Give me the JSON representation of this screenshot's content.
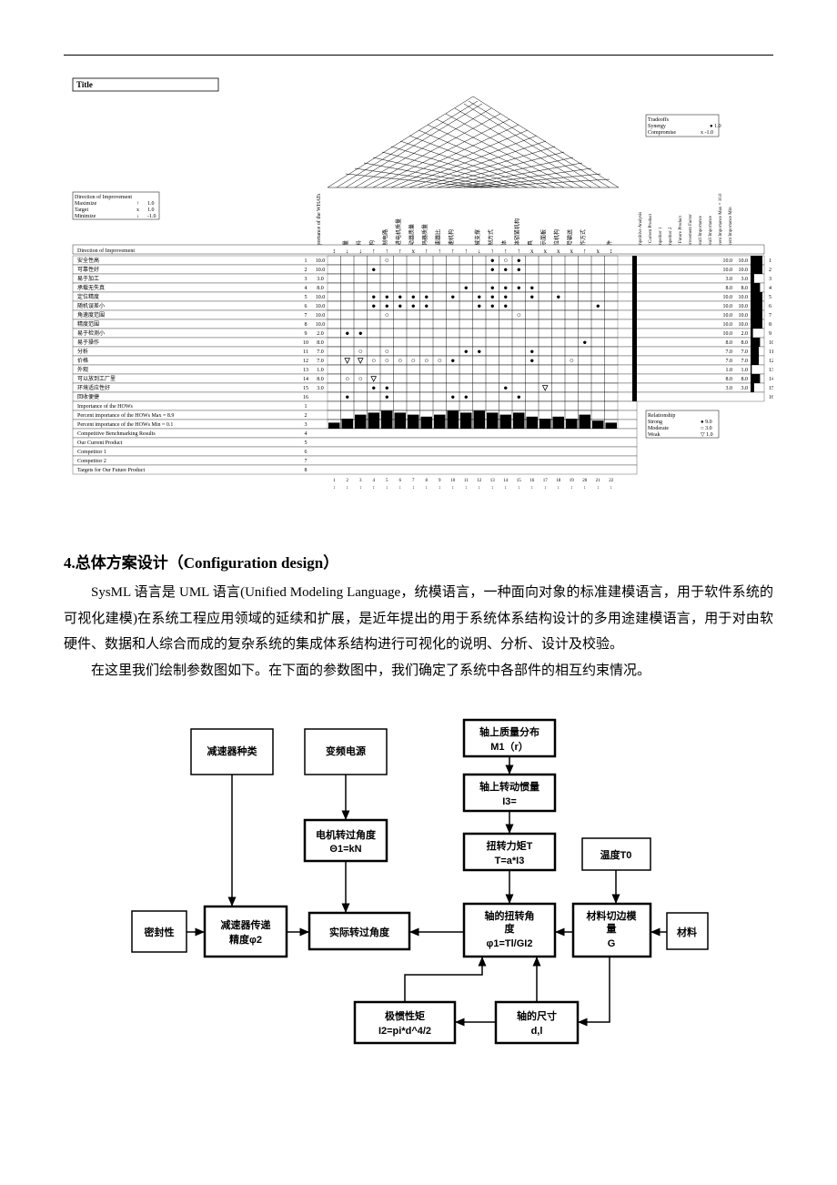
{
  "qfd": {
    "title_label": "Title",
    "legend_improve": {
      "header": "Direction of Improvement",
      "rows": [
        [
          "Maximize",
          "↑",
          "1.0"
        ],
        [
          "Target",
          "x",
          "1.0"
        ],
        [
          "Minimize",
          "↓",
          "-1.0"
        ]
      ]
    },
    "legend_tradeoff": {
      "header": "Tradeoffs",
      "rows": [
        [
          "Synergy",
          "● 1.0"
        ],
        [
          "Compromise",
          "x -1.0"
        ]
      ]
    },
    "legend_rel": {
      "header": "Relationship",
      "rows": [
        [
          "Strong",
          "● 9.0"
        ],
        [
          "Moderate",
          "○ 3.0"
        ],
        [
          "Weak",
          "▽ 1.0"
        ]
      ]
    },
    "row_header_improve": "Direction of Improvement",
    "col_importance": "Importance of the WHATs",
    "whats": [
      {
        "n": "1",
        "label": "安全性高",
        "imp": "10.0",
        "vals": [
          "10.0",
          "10.0"
        ]
      },
      {
        "n": "2",
        "label": "可靠性好",
        "imp": "10.0",
        "vals": [
          "10.0",
          "10.0"
        ]
      },
      {
        "n": "3",
        "label": "易于加工",
        "imp": "3.0",
        "vals": [
          "3.0",
          "3.0"
        ]
      },
      {
        "n": "4",
        "label": "承载无失真",
        "imp": "8.0",
        "vals": [
          "8.0",
          "8.0"
        ]
      },
      {
        "n": "5",
        "label": "定位精度",
        "imp": "10.0",
        "vals": [
          "10.0",
          "10.0"
        ]
      },
      {
        "n": "6",
        "label": "随机误差小",
        "imp": "10.0",
        "vals": [
          "10.0",
          "10.0"
        ]
      },
      {
        "n": "7",
        "label": "角速度范围",
        "imp": "10.0",
        "vals": [
          "10.0",
          "10.0"
        ]
      },
      {
        "n": "8",
        "label": "精度范围",
        "imp": "10.0",
        "vals": [
          "10.0",
          "10.0"
        ]
      },
      {
        "n": "9",
        "label": "易于检测小",
        "imp": "2.0",
        "vals": [
          "10.0",
          "2.0"
        ]
      },
      {
        "n": "10",
        "label": "易于操作",
        "imp": "8.0",
        "vals": [
          "8.0",
          "8.0"
        ]
      },
      {
        "n": "11",
        "label": "分析",
        "imp": "7.0",
        "vals": [
          "7.0",
          "7.0"
        ]
      },
      {
        "n": "12",
        "label": "价格",
        "imp": "7.0",
        "vals": [
          "7.0",
          "7.0"
        ]
      },
      {
        "n": "13",
        "label": "外观",
        "imp": "1.0",
        "vals": [
          "1.0",
          "1.0"
        ]
      },
      {
        "n": "14",
        "label": "可以放到工厂里",
        "imp": "8.0",
        "vals": [
          "8.0",
          "8.0"
        ]
      },
      {
        "n": "15",
        "label": "环境适应性好",
        "imp": "3.0",
        "vals": [
          "3.0",
          "3.0"
        ]
      },
      {
        "n": "16",
        "label": "回收便捷",
        "imp": "",
        "vals": [
          "",
          ""
        ]
      }
    ],
    "hows": [
      "n/a",
      "质量",
      "材料",
      "结构",
      "控制电路",
      "步进电机质量",
      "驱动器质量",
      "编码器质量",
      "减速器比",
      "减速机构",
      "n/a",
      "机械支撑",
      "控制方式",
      "车体",
      "车体锁紧机构",
      "夹具",
      "显示面板",
      "定位机构",
      "信号输送",
      "工作方式",
      "n/a",
      "附件"
    ],
    "row_imp_hows": "Importance of the HOWs",
    "row_pct_hows": "Percent importance of the HOWs",
    "row_max": "Max = 8.9",
    "row_min": "Min = 0.1",
    "row_bench": "Competitive Benchmarking Results",
    "row_our": "Our Current Product",
    "row_c1": "Competitor 1",
    "row_c2": "Competitor 2",
    "row_targets": "Targets for Our Future Product",
    "side_cols": [
      "Competitive Analysis",
      "Our Current Product",
      "Competitor 1",
      "Competitor 2",
      "Our Future Product",
      "Improvement Factor",
      "Overall Importance",
      "Overall Importance",
      "Percent Importance Max = 10.0",
      "Percent Importance Min"
    ]
  },
  "section": {
    "heading": "4.总体方案设计（Configuration design）",
    "p1a": "SysML 语言是 UML 语言(Unified Modeling Language，统模语言，一种面向对象的标准建模语言，用于软件系统的可视化建模)在系统工程应用领域的延续和扩展，是近年提出的用于系统体系结构设计的多用途建模语言，用于对由软硬件、数据和人综合而成的复杂系统的集成体系结构进行可视化的说明、分析、设计及校验。",
    "p2": "在这里我们绘制参数图如下。在下面的参数图中，我们确定了系统中各部件的相互约束情况。"
  },
  "diagram": {
    "b_reducer_type": "减速器种类",
    "b_vfd": "变频电源",
    "b_mass_dist_1": "轴上质量分布",
    "b_mass_dist_2": "M1（r）",
    "b_inertia_1": "轴上转动惯量",
    "b_inertia_2": "I3=",
    "b_motor_angle_1": "电机转过角度",
    "b_motor_angle_2": "Θ1=kN",
    "b_torque_1": "扭转力矩T",
    "b_torque_2": "T=a*I3",
    "b_temp": "温度T0",
    "b_seal": "密封性",
    "b_reducer_acc_1": "减速器传递",
    "b_reducer_acc_2": "精度φ2",
    "b_actual_angle": "实际转过角度",
    "b_twist_1": "轴的扭转角",
    "b_twist_2": "度",
    "b_twist_3": "φ1=Tl/GI2",
    "b_shear_1": "材料切边模",
    "b_shear_2": "量",
    "b_shear_3": "G",
    "b_material": "材料",
    "b_polar_1": "极惯性矩",
    "b_polar_2": "I2=pi*d^4/2",
    "b_dim_1": "轴的尺寸",
    "b_dim_2": "d,l"
  }
}
